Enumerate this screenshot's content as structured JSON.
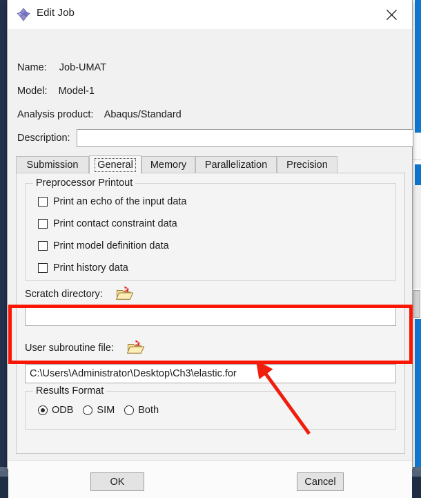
{
  "window": {
    "title": "Edit Job",
    "icon": "abaqus-diamond-icon",
    "close_icon": "close-icon"
  },
  "fields": {
    "name_label": "Name:",
    "name_value": "Job-UMAT",
    "model_label": "Model:",
    "model_value": "Model-1",
    "analysis_label": "Analysis product:",
    "analysis_value": "Abaqus/Standard",
    "description_label": "Description:",
    "description_value": "",
    "description_placeholder": ""
  },
  "tabs": {
    "items": [
      {
        "label": "Submission",
        "active": false
      },
      {
        "label": "General",
        "active": true
      },
      {
        "label": "Memory",
        "active": false
      },
      {
        "label": "Parallelization",
        "active": false
      },
      {
        "label": "Precision",
        "active": false
      }
    ]
  },
  "general": {
    "preprocessor_group": {
      "legend": "Preprocessor Printout",
      "checkboxes": [
        {
          "label": "Print an echo of the input data",
          "checked": false
        },
        {
          "label": "Print contact constraint data",
          "checked": false
        },
        {
          "label": "Print model definition data",
          "checked": false
        },
        {
          "label": "Print history data",
          "checked": false
        }
      ]
    },
    "scratch": {
      "label": "Scratch directory:",
      "browse_icon": "open-folder-icon",
      "value": "",
      "placeholder": ""
    },
    "user_subroutine": {
      "label": "User subroutine file:",
      "browse_icon": "open-folder-icon",
      "value": "C:\\Users\\Administrator\\Desktop\\Ch3\\elastic.for",
      "placeholder": ""
    },
    "results_format": {
      "legend": "Results Format",
      "options": [
        {
          "label": "ODB",
          "selected": true
        },
        {
          "label": "SIM",
          "selected": false
        },
        {
          "label": "Both",
          "selected": false
        }
      ]
    }
  },
  "footer": {
    "ok_label": "OK",
    "cancel_label": "Cancel"
  },
  "annotation": {
    "highlight_color": "#fa1605",
    "arrow_color": "#f01e0d"
  }
}
